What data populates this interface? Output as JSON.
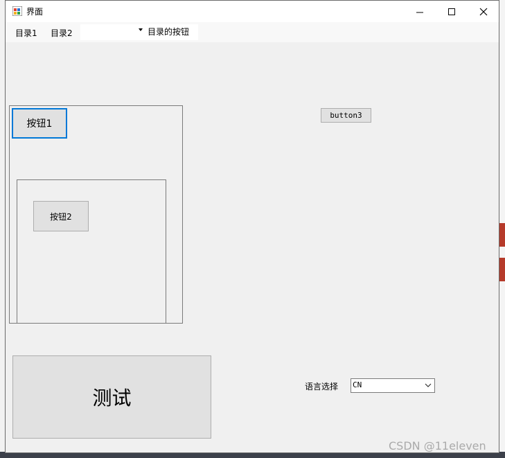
{
  "window": {
    "title": "界面"
  },
  "menubar": {
    "items": [
      "目录1",
      "目录2"
    ],
    "combo_value": "",
    "button_label": "目录的按钮"
  },
  "buttons": {
    "button1": "按钮1",
    "button2": "按钮2",
    "button3": "button3",
    "test": "测试"
  },
  "language": {
    "label": "语言选择",
    "value": "CN"
  },
  "watermark": "CSDN @11eleven",
  "colors": {
    "focus_border": "#0078d7",
    "window_bg": "#f0f0f0",
    "button_bg": "#e1e1e1"
  }
}
